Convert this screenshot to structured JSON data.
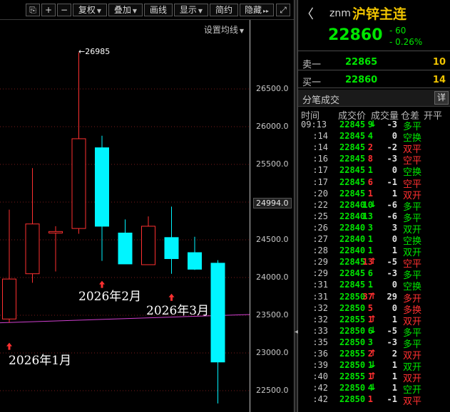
{
  "toolbar": {
    "buttons": [
      {
        "label": "⎘",
        "icon": "lock-icon"
      },
      {
        "label": "+"
      },
      {
        "label": "−"
      },
      {
        "label": "复权",
        "dropdown": true
      },
      {
        "label": "叠加",
        "dropdown": true
      },
      {
        "label": "画线"
      },
      {
        "label": "显示",
        "dropdown": true
      },
      {
        "label": "简约"
      },
      {
        "label": "隐藏",
        "dropdown": true
      },
      {
        "label": "⤢",
        "icon": "fullscreen-icon"
      }
    ],
    "settings_label": "设置均线"
  },
  "chart": {
    "price_labels": [
      "26500.0",
      "26000.0",
      "25500.0",
      "25000.0",
      "24500.0",
      "24000.0",
      "23500.0",
      "23000.0",
      "22500.0"
    ],
    "current_price_label": "24994.0",
    "high_label": "26985",
    "date_labels": [
      "2026年1月",
      "2026年2月",
      "2026年3月"
    ],
    "colors": {
      "up": "#ff3030",
      "down": "#00f5ff",
      "ma": "#d040d0",
      "grid": "#7a1a1a"
    }
  },
  "chart_data": {
    "type": "candlestick",
    "price_axis": {
      "min": 22300,
      "max": 27000
    },
    "candles": [
      {
        "open": 23450,
        "high": 24900,
        "low": 23400,
        "close": 23980
      },
      {
        "open": 24050,
        "high": 25450,
        "low": 23930,
        "close": 24710
      },
      {
        "open": 24590,
        "high": 24680,
        "low": 24080,
        "close": 24610
      },
      {
        "open": 24650,
        "high": 26985,
        "low": 24580,
        "close": 25840
      },
      {
        "open": 25720,
        "high": 25880,
        "low": 24220,
        "close": 24680
      },
      {
        "open": 24590,
        "high": 24770,
        "low": 24190,
        "close": 24180
      },
      {
        "open": 24170,
        "high": 24810,
        "low": 24170,
        "close": 24680
      },
      {
        "open": 24530,
        "high": 24940,
        "low": 24050,
        "close": 24250
      },
      {
        "open": 24330,
        "high": 24540,
        "low": 24100,
        "close": 24110
      },
      {
        "open": 24190,
        "high": 24230,
        "low": 22330,
        "close": 22880
      }
    ],
    "moving_average": {
      "start": 23400,
      "end": 23510
    },
    "markers": [
      0,
      4,
      7
    ]
  },
  "quote": {
    "back_icon": "back-arrow-icon",
    "back": "〈",
    "code": "znm",
    "name": "沪锌主连",
    "last": "22860",
    "change": "- 60",
    "change_pct": "- 0.26%",
    "ask_label": "卖一",
    "ask_price": "22865",
    "ask_vol": "10",
    "bid_label": "买一",
    "bid_price": "22860",
    "bid_vol": "14"
  },
  "ticks": {
    "title": "分笔成交",
    "detail": "详",
    "headers": [
      "时间",
      "成交价",
      "成交量",
      "仓差",
      "开平"
    ],
    "rows": [
      {
        "time": "09:13",
        "price": "22845",
        "dir": "down",
        "vol": "9",
        "vol_color": "dn",
        "oi": "-3",
        "nature": "多平",
        "nat_color": "dn"
      },
      {
        "time": ":14",
        "price": "22845",
        "dir": "",
        "vol": "4",
        "vol_color": "dn",
        "oi": "0",
        "nature": "空换",
        "nat_color": "dn"
      },
      {
        "time": ":14",
        "price": "22845",
        "dir": "",
        "vol": "2",
        "vol_color": "up",
        "oi": "-2",
        "nature": "双平",
        "nat_color": "up"
      },
      {
        "time": ":16",
        "price": "22845",
        "dir": "",
        "vol": "8",
        "vol_color": "up",
        "oi": "-3",
        "nature": "空平",
        "nat_color": "up"
      },
      {
        "time": ":17",
        "price": "22845",
        "dir": "",
        "vol": "1",
        "vol_color": "dn",
        "oi": "0",
        "nature": "空换",
        "nat_color": "dn"
      },
      {
        "time": ":17",
        "price": "22845",
        "dir": "",
        "vol": "6",
        "vol_color": "up",
        "oi": "-1",
        "nature": "空平",
        "nat_color": "up"
      },
      {
        "time": ":20",
        "price": "22845",
        "dir": "",
        "vol": "1",
        "vol_color": "up",
        "oi": "1",
        "nature": "双开",
        "nat_color": "up"
      },
      {
        "time": ":22",
        "price": "22840",
        "dir": "down",
        "vol": "10",
        "vol_color": "dn",
        "oi": "-6",
        "nature": "多平",
        "nat_color": "dn"
      },
      {
        "time": ":25",
        "price": "22840",
        "dir": "",
        "vol": "13",
        "vol_color": "dn",
        "oi": "-6",
        "nature": "多平",
        "nat_color": "dn"
      },
      {
        "time": ":26",
        "price": "22840",
        "dir": "",
        "vol": "3",
        "vol_color": "dn",
        "oi": "3",
        "nature": "双开",
        "nat_color": "dn"
      },
      {
        "time": ":27",
        "price": "22840",
        "dir": "",
        "vol": "1",
        "vol_color": "dn",
        "oi": "0",
        "nature": "空换",
        "nat_color": "dn"
      },
      {
        "time": ":28",
        "price": "22840",
        "dir": "",
        "vol": "1",
        "vol_color": "dn",
        "oi": "1",
        "nature": "双开",
        "nat_color": "dn"
      },
      {
        "time": ":29",
        "price": "22845",
        "dir": "up",
        "vol": "13",
        "vol_color": "up",
        "oi": "-5",
        "nature": "空平",
        "nat_color": "up"
      },
      {
        "time": ":29",
        "price": "22845",
        "dir": "",
        "vol": "6",
        "vol_color": "dn",
        "oi": "-3",
        "nature": "多平",
        "nat_color": "dn"
      },
      {
        "time": ":31",
        "price": "22845",
        "dir": "",
        "vol": "1",
        "vol_color": "dn",
        "oi": "0",
        "nature": "空换",
        "nat_color": "dn"
      },
      {
        "time": ":31",
        "price": "22850",
        "dir": "up",
        "vol": "37",
        "vol_color": "up",
        "oi": "29",
        "nature": "多开",
        "nat_color": "up"
      },
      {
        "time": ":32",
        "price": "22850",
        "dir": "",
        "vol": "5",
        "vol_color": "up",
        "oi": "0",
        "nature": "多换",
        "nat_color": "up"
      },
      {
        "time": ":32",
        "price": "22855",
        "dir": "up",
        "vol": "1",
        "vol_color": "up",
        "oi": "1",
        "nature": "双开",
        "nat_color": "up"
      },
      {
        "time": ":33",
        "price": "22850",
        "dir": "down",
        "vol": "6",
        "vol_color": "dn",
        "oi": "-5",
        "nature": "多平",
        "nat_color": "dn"
      },
      {
        "time": ":35",
        "price": "22850",
        "dir": "",
        "vol": "3",
        "vol_color": "dn",
        "oi": "-3",
        "nature": "多平",
        "nat_color": "dn"
      },
      {
        "time": ":36",
        "price": "22855",
        "dir": "up",
        "vol": "2",
        "vol_color": "up",
        "oi": "2",
        "nature": "双开",
        "nat_color": "up"
      },
      {
        "time": ":39",
        "price": "22850",
        "dir": "down",
        "vol": "1",
        "vol_color": "dn",
        "oi": "1",
        "nature": "双开",
        "nat_color": "dn"
      },
      {
        "time": ":40",
        "price": "22855",
        "dir": "up",
        "vol": "1",
        "vol_color": "up",
        "oi": "1",
        "nature": "双开",
        "nat_color": "up"
      },
      {
        "time": ":42",
        "price": "22850",
        "dir": "down",
        "vol": "4",
        "vol_color": "dn",
        "oi": "1",
        "nature": "空开",
        "nat_color": "dn"
      },
      {
        "time": ":42",
        "price": "22850",
        "dir": "",
        "vol": "1",
        "vol_color": "up",
        "oi": "-1",
        "nature": "双平",
        "nat_color": "up"
      }
    ]
  }
}
